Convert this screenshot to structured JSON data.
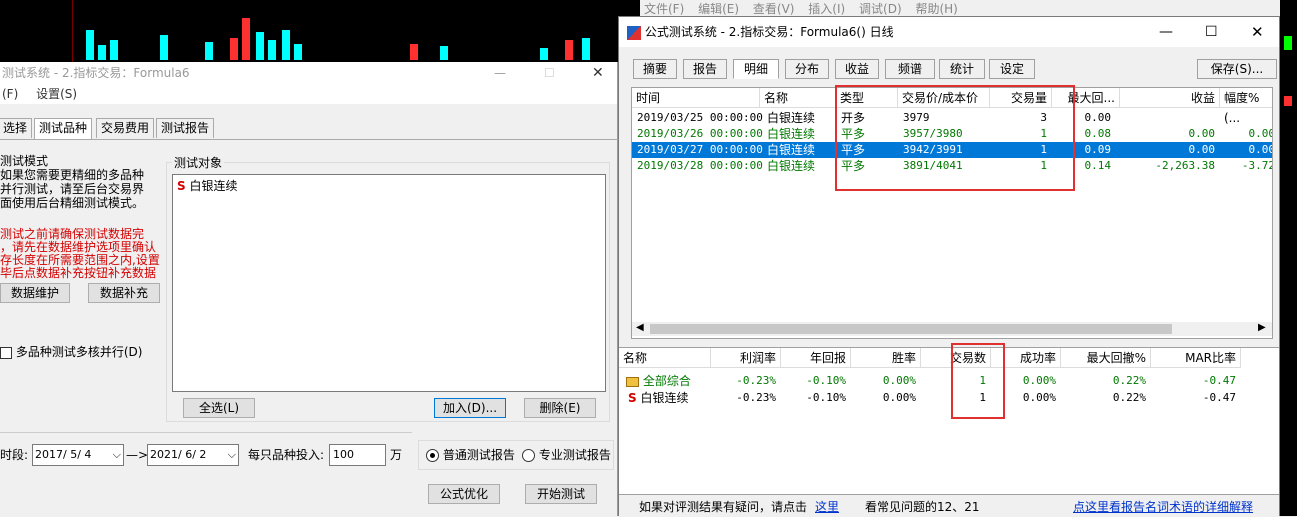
{
  "colors": {
    "accent": "#0078d7",
    "profit_green": "#007800",
    "warn_red": "#d40000",
    "highlight_box": "#e03030"
  },
  "left_window": {
    "title": "测试系统 - 2.指标交易：Formula6",
    "menu": [
      "(F)",
      "设置(S)"
    ],
    "tabs": [
      "选择",
      "测试品种",
      "交易费用",
      "测试报告"
    ],
    "mode_group": "测试模式",
    "mode_text": [
      "如果您需要更精细的多品种",
      "并行测试，请至后台交易界",
      "面使用后台精细测试模式。"
    ],
    "warn_text": [
      "测试之前请确保测试数据完",
      "，请先在数据维护选项里确认",
      "存长度在所需要范围之内,设置",
      "毕后点数据补充按钮补充数据"
    ],
    "btn_maintain": "数据维护",
    "btn_supplement": "数据补充",
    "multicore_label": "多品种测试多核并行(D)",
    "target_group": "测试对象",
    "target_item_icon": "S",
    "target_item": "白银连续",
    "btn_select_all": "全选(L)",
    "btn_add": "加入(D)...",
    "btn_delete": "删除(E)",
    "period_label": "时段:",
    "date_from": "2017/ 5/ 4",
    "arrow": "—>",
    "date_to": "2021/ 6/ 2",
    "invest_label": "每只品种投入:",
    "invest_value": "100",
    "invest_unit": "万",
    "radio_normal": "普通测试报告",
    "radio_pro": "专业测试报告",
    "btn_optimize": "公式优化",
    "btn_start": "开始测试"
  },
  "right_window": {
    "title": "公式测试系统 - 2.指标交易：Formula6() 日线",
    "tabs": [
      "摘要",
      "报告",
      "明细",
      "分布",
      "收益",
      "频谱",
      "统计",
      "设定"
    ],
    "save_label": "保存(S)...",
    "detail_headers": [
      "时间",
      "名称",
      "类型",
      "交易价/成本价",
      "交易量",
      "最大回...",
      "收益",
      "幅度%(..."
    ],
    "detail_rows": [
      {
        "time": "2019/03/25 00:00:00",
        "name": "白银连续",
        "type": "开多",
        "price": "3979",
        "qty": "3",
        "maxdd": "0.00",
        "profit": "",
        "pct": ""
      },
      {
        "time": "2019/03/26 00:00:00",
        "name": "白银连续",
        "type": "平多",
        "price": "3957/3980",
        "qty": "1",
        "maxdd": "0.08",
        "profit": "0.00",
        "pct": "0.00"
      },
      {
        "time": "2019/03/27 00:00:00",
        "name": "白银连续",
        "type": "平多",
        "price": "3942/3991",
        "qty": "1",
        "maxdd": "0.09",
        "profit": "0.00",
        "pct": "0.00"
      },
      {
        "time": "2019/03/28 00:00:00",
        "name": "白银连续",
        "type": "平多",
        "price": "3891/4041",
        "qty": "1",
        "maxdd": "0.14",
        "profit": "-2,263.38",
        "pct": "-3.72"
      }
    ],
    "summary_headers": [
      "名称",
      "利润率",
      "年回报",
      "胜率",
      "交易数",
      "成功率",
      "最大回撤%",
      "MAR比率"
    ],
    "summary_rows": [
      {
        "name": "全部综合",
        "profit_rate": "-0.23%",
        "annual": "-0.10%",
        "win": "0.00%",
        "trades": "1",
        "success": "0.00%",
        "maxdd": "0.22%",
        "mar": "-0.47"
      },
      {
        "name": "白银连续",
        "profit_rate": "-0.23%",
        "annual": "-0.10%",
        "win": "0.00%",
        "trades": "1",
        "success": "0.00%",
        "maxdd": "0.22%",
        "mar": "-0.47"
      }
    ],
    "summary_row2_icon": "S",
    "footer_text": "如果对评测结果有疑问，请点击",
    "footer_link": "这里",
    "footer_faq": "看常见问题的12、21",
    "footer_link2": "点这里看报告名词术语的详细解释"
  },
  "bg_menu": [
    "文件(F)",
    "编辑(E)",
    "查看(V)",
    "插入(I)",
    "调试(D)",
    "帮助(H)"
  ]
}
